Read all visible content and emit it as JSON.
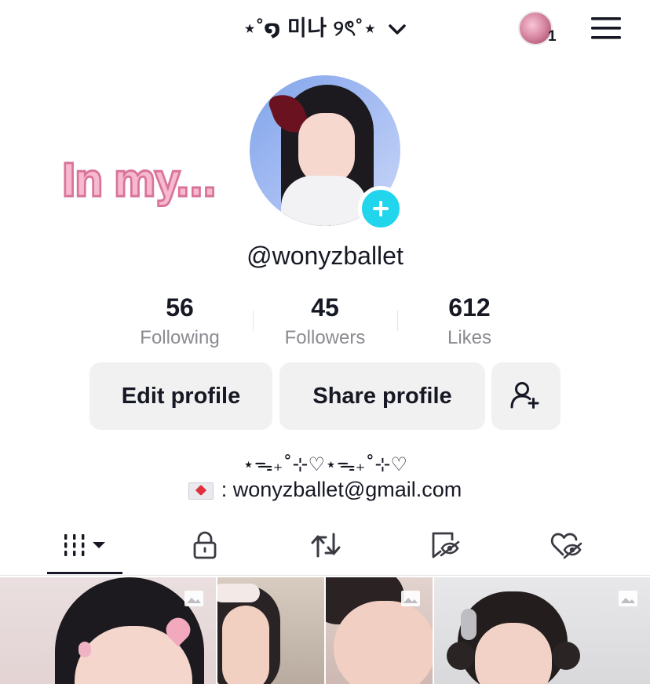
{
  "header": {
    "username_display": "⋆˚໑ 미나 ୨ৎ˚⋆",
    "story_count": "1",
    "icons": {
      "dropdown": "chevron-down-icon",
      "menu": "hamburger-menu-icon"
    }
  },
  "profile": {
    "bio_sticker": "In my...",
    "handle": "@wonyzballet",
    "add_icon": "plus-icon"
  },
  "stats": [
    {
      "value": "56",
      "label": "Following"
    },
    {
      "value": "45",
      "label": "Followers"
    },
    {
      "value": "612",
      "label": "Likes"
    }
  ],
  "actions": {
    "edit": "Edit profile",
    "share": "Share profile",
    "add_friend_icon": "add-friend-icon"
  },
  "bio": {
    "line1": "⋆ᯓ₊˚⊹♡⋆ᯓ₊˚⊹♡",
    "line2": ": wonyzballet@gmail.com"
  },
  "tabs": [
    {
      "icon": "grid-icon",
      "active": true
    },
    {
      "icon": "lock-icon",
      "active": false
    },
    {
      "icon": "repost-icon",
      "active": false
    },
    {
      "icon": "favorites-icon",
      "active": false
    },
    {
      "icon": "liked-icon",
      "active": false
    }
  ],
  "colors": {
    "accent": "#20d5ec",
    "text": "#161823",
    "muted": "#8a8b91",
    "button_bg": "#f1f1f2",
    "sticker_pink": "#f7b9cf"
  }
}
